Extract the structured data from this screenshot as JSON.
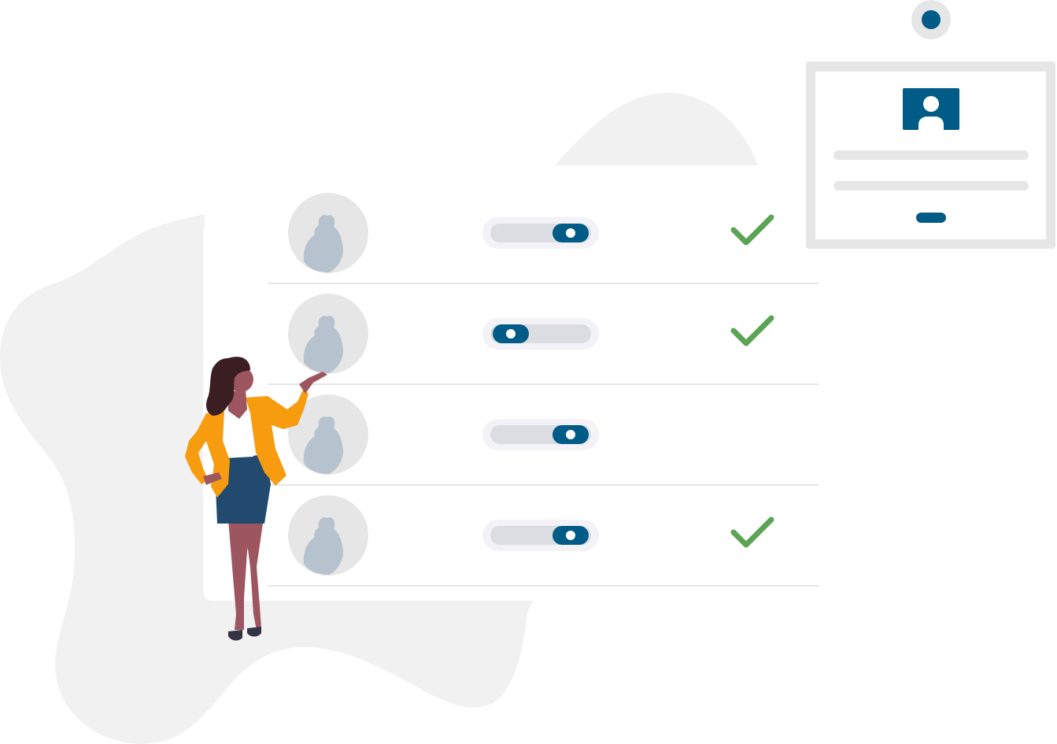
{
  "colors": {
    "background": "#ffffff",
    "blob": "#f1f1f1",
    "panel": "#ffffff",
    "divider": "#e6e6e6",
    "avatar_bg": "#e6e6e6",
    "avatar_silhouette": "#b6c2cd",
    "toggle_outer": "#f2f2f7",
    "toggle_track": "#dcdde3",
    "accent": "#005b87",
    "check": "#5aa454",
    "frame": "#e6e6e6",
    "skin": "#9d5660",
    "hair": "#3b1e22",
    "jacket": "#f79b0f",
    "skirt": "#224a6e",
    "shoe": "#333344"
  },
  "rows": [
    {
      "avatar": "user-silhouette-icon",
      "toggle_on": true,
      "checked": true
    },
    {
      "avatar": "user-silhouette-icon",
      "toggle_on": false,
      "checked": true
    },
    {
      "avatar": "user-silhouette-icon",
      "toggle_on": true,
      "checked": false
    },
    {
      "avatar": "user-silhouette-icon",
      "toggle_on": true,
      "checked": true
    }
  ],
  "profile_card": {
    "icon": "user-profile-icon",
    "text_line_count": 2,
    "button_color": "#005b87"
  },
  "indicator": {
    "icon": "circle-dot-icon"
  }
}
